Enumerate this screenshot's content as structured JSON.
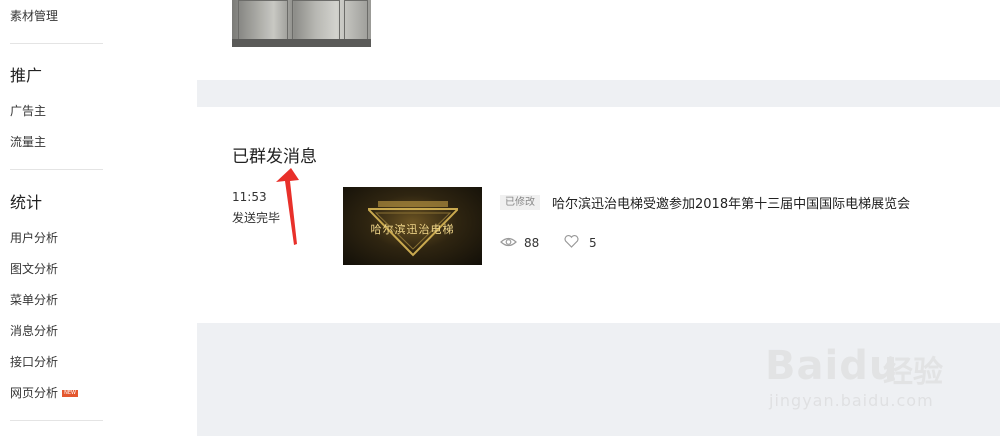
{
  "sidebar": {
    "top_item": "素材管理",
    "promotion": {
      "heading": "推广",
      "items": [
        "广告主",
        "流量主"
      ]
    },
    "stats": {
      "heading": "统计",
      "items": [
        "用户分析",
        "图文分析",
        "菜单分析",
        "消息分析",
        "接口分析",
        "网页分析"
      ],
      "new_badge": "NEW"
    }
  },
  "sent": {
    "title": "已群发消息",
    "time": "11:53",
    "status": "发送完毕",
    "thumbnail_text": "哈尔滨迅治电梯",
    "tag": "已修改",
    "article_title": "哈尔滨迅治电梯受邀参加2018年第十三届中国国际电梯展览会",
    "views": "88",
    "likes": "5"
  },
  "icons": {
    "views": "eye-icon",
    "likes": "heart-icon"
  },
  "annotation_color": "#e8302a",
  "watermark": {
    "logo": "Baidu",
    "cn": "经验",
    "url": "jingyan.baidu.com"
  }
}
